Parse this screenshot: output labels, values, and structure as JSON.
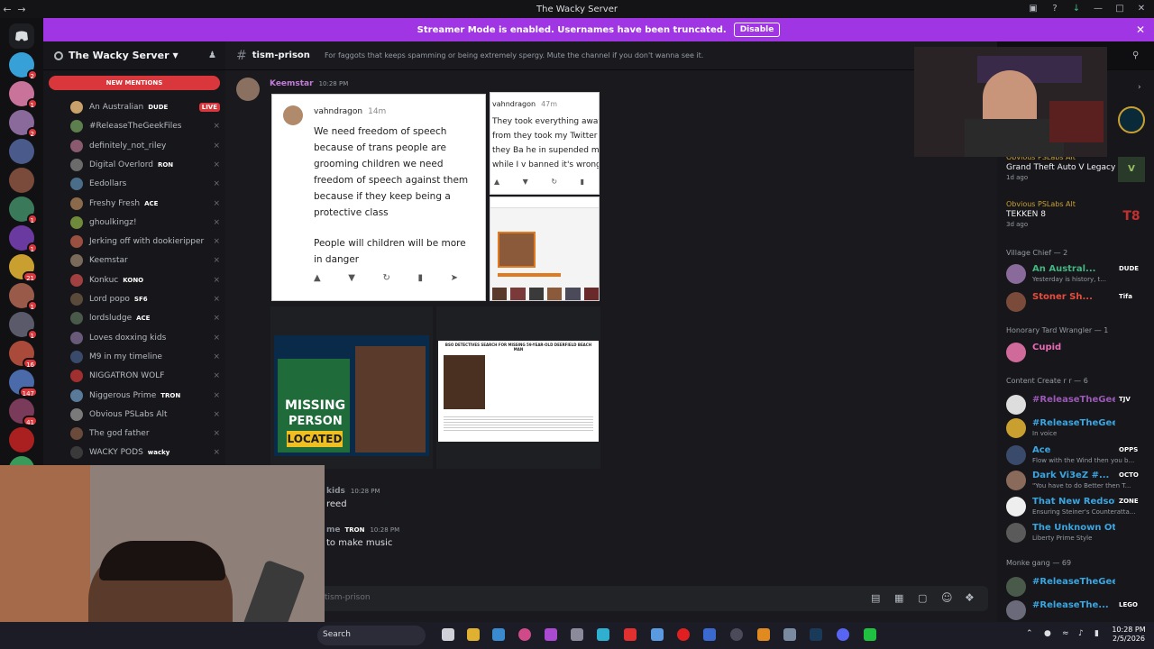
{
  "window": {
    "title": "The Wacky Server"
  },
  "banner": {
    "text": "Streamer Mode is enabled. Usernames have been truncated.",
    "button": "Disable"
  },
  "server": {
    "name": "The Wacky Server",
    "new_mentions": "NEW MENTIONS",
    "voice_members": [
      {
        "name": "An Australian",
        "tag": "DUDE",
        "badge": "LIVE",
        "color": "#c9a26b"
      },
      {
        "name": "#ReleaseTheGeekFiles",
        "tag": "",
        "badge": "",
        "color": "#5d7f4e"
      },
      {
        "name": "definitely_not_riley",
        "tag": "",
        "badge": "",
        "color": "#8a5a6e"
      },
      {
        "name": "Digital Overlord",
        "tag": "RON",
        "badge": "",
        "color": "#6b6b6b"
      },
      {
        "name": "Eedollars",
        "tag": "",
        "badge": "",
        "color": "#4a6e8a"
      },
      {
        "name": "Freshy Fresh",
        "tag": "ACE",
        "badge": "",
        "color": "#8a6a4a"
      },
      {
        "name": "ghoulkingz!",
        "tag": "",
        "badge": "",
        "color": "#6e8a3a"
      },
      {
        "name": "Jerking off with dookieripper",
        "tag": "",
        "badge": "",
        "color": "#9a5040"
      },
      {
        "name": "Keemstar",
        "tag": "",
        "badge": "",
        "color": "#7a6a5a"
      },
      {
        "name": "Konkuc",
        "tag": "KONO",
        "badge": "",
        "color": "#a04040"
      },
      {
        "name": "Lord popo",
        "tag": "SF6",
        "badge": "",
        "color": "#5a4a3a"
      },
      {
        "name": "lordsludge",
        "tag": "ACE",
        "badge": "",
        "color": "#4a5a4a"
      },
      {
        "name": "Loves doxxing kids",
        "tag": "",
        "badge": "",
        "color": "#6a5a7a"
      },
      {
        "name": "M9 in my timeline",
        "tag": "",
        "badge": "",
        "color": "#3a4a6a"
      },
      {
        "name": "NIGGATRON WOLF",
        "tag": "",
        "badge": "",
        "color": "#a03030"
      },
      {
        "name": "Niggerous Prime",
        "tag": "TRON",
        "badge": "",
        "color": "#5a7a9a"
      },
      {
        "name": "Obvious PSLabs Alt",
        "tag": "",
        "badge": "",
        "color": "#7a7a7a"
      },
      {
        "name": "The god father",
        "tag": "",
        "badge": "",
        "color": "#6a4a3a"
      },
      {
        "name": "WACKY PODS",
        "tag": "wacky",
        "badge": "",
        "color": "#3a3a3a"
      }
    ]
  },
  "channel": {
    "name": "tism-prison",
    "topic": "For faggots that keeps spamming or being extremely spergy. Mute the channel if you don't wanna see it.",
    "input_placeholder": "tism-prison"
  },
  "messages": [
    {
      "author": "Keemstar",
      "time": "10:28 PM",
      "color": "#c27cd9"
    },
    {
      "author": "kids",
      "time": "10:28 PM",
      "text": "reed",
      "color": "#b5bac1"
    },
    {
      "author": "me",
      "tag": "TRON",
      "time": "10:28 PM",
      "text": "to make music",
      "color": "#b5bac1"
    }
  ],
  "tweet1": {
    "user": "vahndragon",
    "ago": "14m",
    "body": "We need freedom of speech because of trans people are grooming children we need freedom of speech against them because if they keep being a protective class",
    "body2": "People will children will be more in danger"
  },
  "tweet2": {
    "user": "vahndragon",
    "ago": "47m",
    "body": "They took everything away from they took my Twitter they Ba he in supended me while I v banned it's wrong"
  },
  "news": {
    "missing": "MISSING",
    "person": "PERSON",
    "located": "LOCATED",
    "headline": "BSO DETECTIVES SEARCH FOR MISSING 59-YEAR-OLD DEERFIELD BEACH MAN"
  },
  "members": {
    "games": [
      {
        "name": "Obvious PSLabs Alt",
        "game": "Grand Theft Auto V Legacy",
        "ago": "1d ago"
      },
      {
        "name": "Obvious PSLabs Alt",
        "game": "TEKKEN 8",
        "ago": "3d ago"
      }
    ],
    "categories": [
      {
        "label": "Village Chief — 2"
      },
      {
        "label": "Honorary Tard Wrangler — 1"
      },
      {
        "label": "Content Create r r — 6"
      },
      {
        "label": "Monke gang — 69"
      }
    ],
    "list": [
      {
        "name": "An Austral...",
        "tag": "DUDE",
        "sub": "Yesterday is history, t...",
        "color": "#43b581"
      },
      {
        "name": "Stoner Sh...",
        "tag": "Tifa",
        "sub": "",
        "color": "#e74c3c"
      },
      {
        "name": "Cupid",
        "tag": "",
        "sub": "",
        "color": "#e86ab5"
      },
      {
        "name": "#ReleaseTheGeek...",
        "tag": "TJV",
        "sub": "",
        "color": "#9b59b6"
      },
      {
        "name": "#ReleaseTheGeekFiles",
        "tag": "",
        "sub": "In voice",
        "color": "#3ba5e0"
      },
      {
        "name": "Ace",
        "tag": "OPPS",
        "sub": "Flow with the Wind then you b...",
        "color": "#3ba5e0"
      },
      {
        "name": "Dark Vi3eZ #...",
        "tag": "OCTO",
        "sub": "\"You have to do Better then T...",
        "color": "#3ba5e0"
      },
      {
        "name": "That New Redsow",
        "tag": "ZONE",
        "sub": "Ensuring Steiner's Counteratta...",
        "color": "#3ba5e0"
      },
      {
        "name": "The Unknown Otaku",
        "tag": "",
        "sub": "Liberty Prime Style",
        "color": "#3ba5e0"
      },
      {
        "name": "#ReleaseTheGeekFiles",
        "tag": "",
        "sub": "",
        "color": "#3ba5e0"
      },
      {
        "name": "#ReleaseThe...",
        "tag": "LEGO",
        "sub": "",
        "color": "#3ba5e0"
      }
    ]
  },
  "taskbar": {
    "search": "Search",
    "time": "10:28 PM",
    "date": "2/5/2026"
  }
}
